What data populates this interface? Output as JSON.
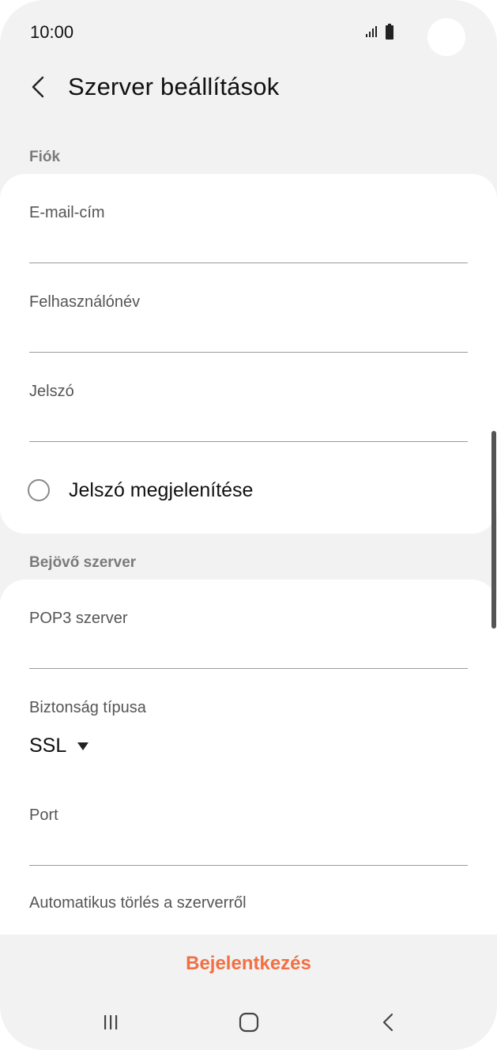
{
  "status_bar": {
    "time": "10:00",
    "icons": [
      "signal-icon",
      "battery-icon"
    ]
  },
  "header": {
    "back_icon": "chevron-left-icon",
    "title": "Szerver beállítások"
  },
  "account_section": {
    "label": "Fiók",
    "email": {
      "label": "E-mail-cím",
      "value": ""
    },
    "username": {
      "label": "Felhasználónév",
      "value": ""
    },
    "password": {
      "label": "Jelszó",
      "value": ""
    },
    "show_password": {
      "label": "Jelszó megjelenítése",
      "checked": false
    }
  },
  "incoming_section": {
    "label": "Bejövő szerver",
    "pop3_server": {
      "label": "POP3 szerver",
      "value": ""
    },
    "security_type": {
      "label": "Biztonság típusa",
      "value": "SSL"
    },
    "port": {
      "label": "Port",
      "value": ""
    },
    "auto_delete": {
      "label": "Automatikus törlés a szerverről"
    }
  },
  "footer": {
    "login_label": "Bejelentkezés"
  },
  "nav_bar": {
    "icons": [
      "recent-apps-icon",
      "home-icon",
      "back-icon"
    ]
  },
  "colors": {
    "accent": "#f26f43",
    "background": "#f2f2f2",
    "card": "#ffffff"
  }
}
